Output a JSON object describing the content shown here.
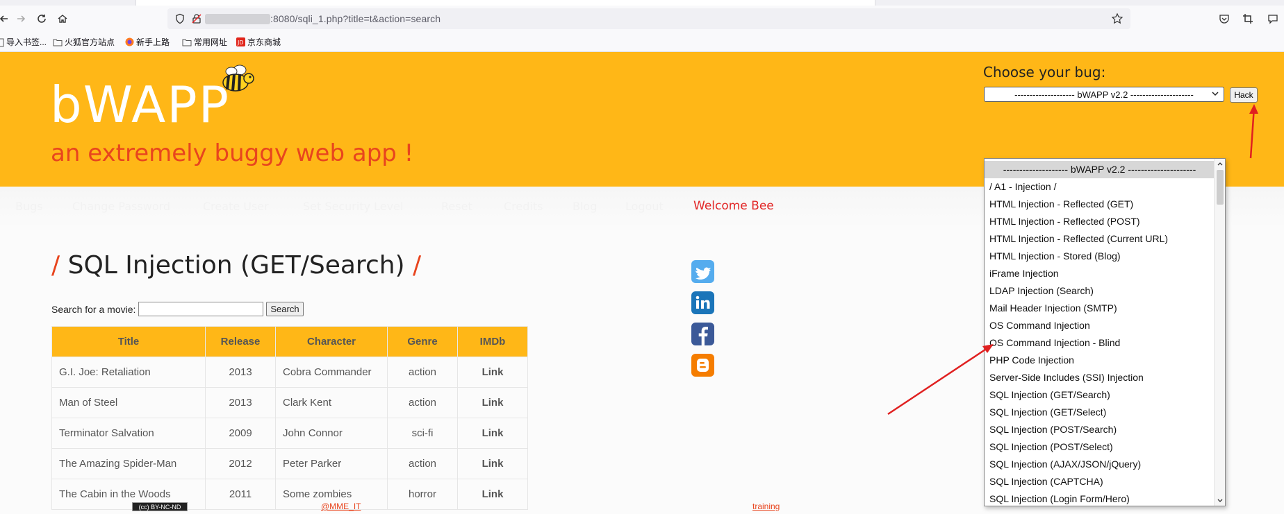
{
  "browser": {
    "url": ":8080/sqli_1.php?title=t&action=search",
    "bookmarks": [
      "导入书签...",
      "火狐官方站点",
      "新手上路",
      "常用网址",
      "京东商城"
    ]
  },
  "header": {
    "logo": "bWAPP",
    "tagline": "an extremely buggy web app !",
    "choose_label": "Choose your bug:",
    "selected_bug": "-------------------- bWAPP v2.2 ---------------------",
    "hack_label": "Hack"
  },
  "menu": {
    "items": [
      "Bugs",
      "Change Password",
      "Create User",
      "Set Security Level",
      "Reset",
      "Credits",
      "Blog",
      "Logout"
    ],
    "welcome": "Welcome Bee"
  },
  "main": {
    "title": "SQL Injection (GET/Search)",
    "slash": "/",
    "search_label": "Search for a movie:",
    "search_value": "",
    "search_button": "Search",
    "table": {
      "headers": [
        "Title",
        "Release",
        "Character",
        "Genre",
        "IMDb"
      ],
      "rows": [
        [
          "G.I. Joe: Retaliation",
          "2013",
          "Cobra Commander",
          "action",
          "Link"
        ],
        [
          "Man of Steel",
          "2013",
          "Clark Kent",
          "action",
          "Link"
        ],
        [
          "Terminator Salvation",
          "2009",
          "John Connor",
          "sci-fi",
          "Link"
        ],
        [
          "The Amazing Spider-Man",
          "2012",
          "Peter Parker",
          "action",
          "Link"
        ],
        [
          "The Cabin in the Woods",
          "2011",
          "Some zombies",
          "horror",
          "Link"
        ]
      ]
    }
  },
  "social": [
    {
      "icon": "twitter-icon",
      "color": "#55acee",
      "glyph": "t"
    },
    {
      "icon": "linkedin-icon",
      "color": "#1b75b9",
      "glyph": "in"
    },
    {
      "icon": "facebook-icon",
      "color": "#3b5998",
      "glyph": "f"
    },
    {
      "icon": "blogger-icon",
      "color": "#f57d00",
      "glyph": "B"
    }
  ],
  "footer": {
    "license": "(cc) BY-NC-ND",
    "link1": "@MME_IT",
    "link2": "training"
  },
  "dropdown": {
    "options": [
      "-------------------- bWAPP v2.2 ---------------------",
      "/ A1 - Injection /",
      "HTML Injection - Reflected (GET)",
      "HTML Injection - Reflected (POST)",
      "HTML Injection - Reflected (Current URL)",
      "HTML Injection - Stored (Blog)",
      "iFrame Injection",
      "LDAP Injection (Search)",
      "Mail Header Injection (SMTP)",
      "OS Command Injection",
      "OS Command Injection - Blind",
      "PHP Code Injection",
      "Server-Side Includes (SSI) Injection",
      "SQL Injection (GET/Search)",
      "SQL Injection (GET/Select)",
      "SQL Injection (POST/Search)",
      "SQL Injection (POST/Select)",
      "SQL Injection (AJAX/JSON/jQuery)",
      "SQL Injection (CAPTCHA)",
      "SQL Injection (Login Form/Hero)"
    ]
  },
  "colors": {
    "header_bg": "#ffb717",
    "accent": "#e8451e",
    "welcome": "#e22727",
    "annotation_arrow": "#e02020"
  }
}
